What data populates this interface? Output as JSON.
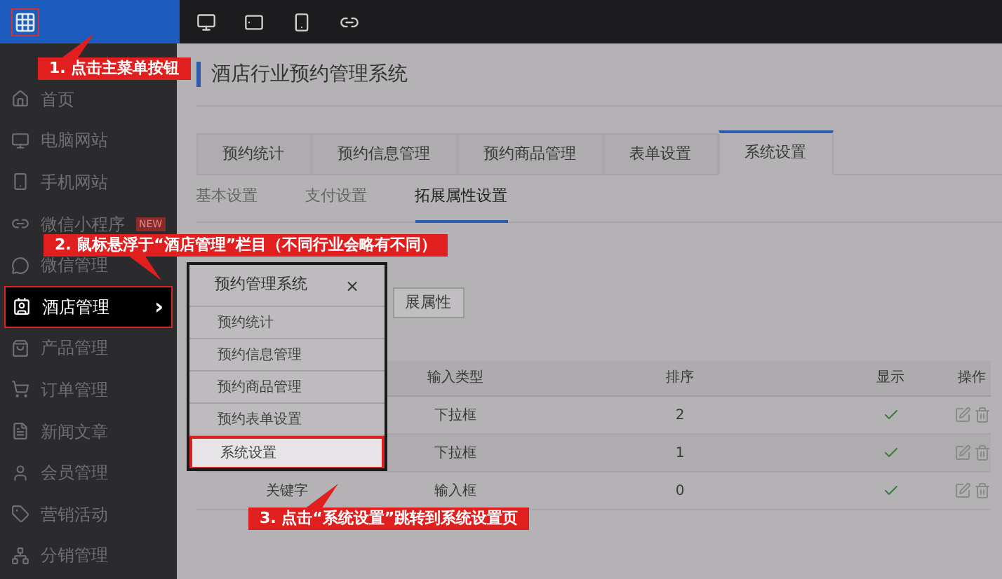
{
  "header": {
    "title": "酒店行业预约管理系统"
  },
  "sidebar": {
    "items": [
      {
        "label": "首页",
        "selected": false
      },
      {
        "label": "电脑网站",
        "selected": false
      },
      {
        "label": "手机网站",
        "selected": false
      },
      {
        "label": "微信小程序",
        "selected": false,
        "badge": "NEW"
      },
      {
        "label": "微信管理",
        "selected": false
      },
      {
        "label": "酒店管理",
        "selected": true,
        "chevron": "›"
      },
      {
        "label": "产品管理",
        "selected": false
      },
      {
        "label": "订单管理",
        "selected": false
      },
      {
        "label": "新闻文章",
        "selected": false
      },
      {
        "label": "会员管理",
        "selected": false
      },
      {
        "label": "营销活动",
        "selected": false
      },
      {
        "label": "分销管理",
        "selected": false
      }
    ]
  },
  "tabs": [
    {
      "label": "预约统计",
      "selected": false
    },
    {
      "label": "预约信息管理",
      "selected": false
    },
    {
      "label": "预约商品管理",
      "selected": false
    },
    {
      "label": "表单设置",
      "selected": false
    },
    {
      "label": "系统设置",
      "selected": true
    }
  ],
  "subtabs": [
    {
      "label": "基本设置",
      "selected": false
    },
    {
      "label": "支付设置",
      "selected": false
    },
    {
      "label": "拓展属性设置",
      "selected": true
    }
  ],
  "add_button": "展属性",
  "table": {
    "columns": [
      "输入类型",
      "排序",
      "显示",
      "操作"
    ],
    "rows": [
      {
        "column_1": "",
        "input_type": "下拉框",
        "order": "2",
        "shown": true
      },
      {
        "column_1": "",
        "input_type": "下拉框",
        "order": "1",
        "shown": true
      },
      {
        "column_1": "关键字",
        "input_type": "输入框",
        "order": "0",
        "shown": true
      }
    ]
  },
  "popup": {
    "title": "预约管理系统",
    "close": "×",
    "items": [
      {
        "label": "预约统计",
        "selected": false
      },
      {
        "label": "预约信息管理",
        "selected": false
      },
      {
        "label": "预约商品管理",
        "selected": false
      },
      {
        "label": "预约表单设置",
        "selected": false
      },
      {
        "label": "系统设置",
        "selected": true
      }
    ]
  },
  "callouts": [
    "1. 点击主菜单按钮",
    "2. 鼠标悬浮于“酒店管理”栏目（不同行业会略有不同）",
    "3. 点击“系统设置”跳转到系统设置页"
  ]
}
